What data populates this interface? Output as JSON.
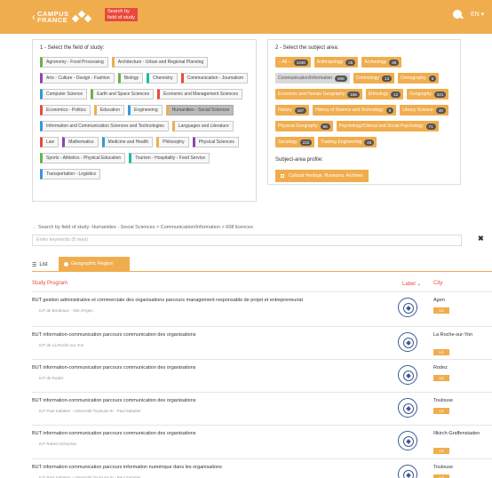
{
  "header": {
    "logo_line1": "CAMPUS",
    "logo_line2": "FRANCE",
    "search_line1": "Search by",
    "search_line2": "field of study",
    "lang": "EN"
  },
  "fields_panel": {
    "title": "1 - Select the field of study:",
    "items": [
      {
        "label": "Agronomy - Food Processing",
        "color": "c-green",
        "selected": false
      },
      {
        "label": "Architecture - Urban and Regional Planning",
        "color": "c-orange",
        "selected": false
      },
      {
        "label": "Arts - Culture - Design - Fashion",
        "color": "c-purple",
        "selected": false
      },
      {
        "label": "Biology",
        "color": "c-green",
        "selected": false
      },
      {
        "label": "Chemistry",
        "color": "c-teal",
        "selected": false
      },
      {
        "label": "Communication - Journalism",
        "color": "c-red",
        "selected": false
      },
      {
        "label": "Computer Science",
        "color": "c-blue",
        "selected": false
      },
      {
        "label": "Earth and Space Sciences",
        "color": "c-green",
        "selected": false
      },
      {
        "label": "Economic and Management Sciences",
        "color": "c-red",
        "selected": false
      },
      {
        "label": "Economics - Politics",
        "color": "c-red",
        "selected": false
      },
      {
        "label": "Education",
        "color": "c-orange",
        "selected": false
      },
      {
        "label": "Engineering",
        "color": "c-blue",
        "selected": false
      },
      {
        "label": "Humanities - Social Sciences",
        "color": "c-orange",
        "selected": true
      },
      {
        "label": "Information and Communication Sciences and Technologies",
        "color": "c-blue",
        "selected": false
      },
      {
        "label": "Languages and Literature",
        "color": "c-orange",
        "selected": false
      },
      {
        "label": "Law",
        "color": "c-red",
        "selected": false
      },
      {
        "label": "Mathematics",
        "color": "c-purple",
        "selected": false
      },
      {
        "label": "Medicine and Health",
        "color": "c-blue",
        "selected": false
      },
      {
        "label": "Philosophy",
        "color": "c-orange",
        "selected": false
      },
      {
        "label": "Physical Sciences",
        "color": "c-purple",
        "selected": false
      },
      {
        "label": "Sports - Athletics - Physical Education",
        "color": "c-green",
        "selected": false
      },
      {
        "label": "Tourism - Hospitality - Food Service",
        "color": "c-teal",
        "selected": false
      },
      {
        "label": "Transportation - Logistics",
        "color": "c-blue",
        "selected": false
      }
    ]
  },
  "subjects_panel": {
    "title": "2 - Select the subject area:",
    "items": [
      {
        "label": "-- All --",
        "count": "1436",
        "selected": false
      },
      {
        "label": "Anthropology",
        "count": "25",
        "selected": false
      },
      {
        "label": "Archeology",
        "count": "46",
        "selected": false
      },
      {
        "label": "Communication/Information",
        "count": "608",
        "selected": true
      },
      {
        "label": "Criminology",
        "count": "13",
        "selected": false
      },
      {
        "label": "Demography",
        "count": "5",
        "selected": false
      },
      {
        "label": "Economic and Human Geography",
        "count": "156",
        "selected": false
      },
      {
        "label": "Ethnology",
        "count": "12",
        "selected": false
      },
      {
        "label": "Geography",
        "count": "321",
        "selected": false
      },
      {
        "label": "History",
        "count": "187",
        "selected": false
      },
      {
        "label": "History of Science and Technology",
        "count": "9",
        "selected": false
      },
      {
        "label": "Library Science",
        "count": "49",
        "selected": false
      },
      {
        "label": "Physical Geography",
        "count": "66",
        "selected": false
      },
      {
        "label": "Psychology/Clinical and Social Psychology",
        "count": "71",
        "selected": false
      },
      {
        "label": "Sociology",
        "count": "222",
        "selected": false
      },
      {
        "label": "Training Engineering",
        "count": "46",
        "selected": false
      }
    ],
    "profile_label": "Subject-area profile:",
    "profile_button": "Cultural Heritage, Museums, Archives"
  },
  "breadcrumb": "Search by field of study: Humanities - Social Sciences > Communication/Information > 608 licences",
  "keywords_placeholder": "Enter keywords (5 max)",
  "tabs": {
    "list": "List",
    "geo": "Geographic Region"
  },
  "table": {
    "col_program": "Study Program",
    "col_label": "Label",
    "col_city": "City",
    "rows": [
      {
        "title": "BUT gestion administrative et commerciale des organisations parcours management responsable de projet et entrepreneuriat",
        "institution": "IUT de Bordeaux - Site d'Agen",
        "city": "Agen",
        "level": "L3"
      },
      {
        "title": "BUT information-communication parcours communication des organisations",
        "institution": "IUT de La Roche sur Yon",
        "city": "La Roche-sur-Yon",
        "level": "L3"
      },
      {
        "title": "BUT information-communication parcours communication des organisations",
        "institution": "IUT de Rodez",
        "city": "Rodez",
        "level": "L3"
      },
      {
        "title": "BUT information-communication parcours communication des organisations",
        "institution": "IUT Paul Sabatier - Université Toulouse III - Paul Sabatier",
        "city": "Toulouse",
        "level": "L3"
      },
      {
        "title": "BUT information-communication parcours communication des organisations",
        "institution": "IUT Robert Schuman",
        "city": "Illkirch-Graffenstaden",
        "level": "L3"
      },
      {
        "title": "BUT information-communication parcours information numérique dans les organisations",
        "institution": "IUT Paul Sabatier - Université Toulouse III - Paul Sabatier",
        "city": "Toulouse",
        "level": "L3"
      }
    ]
  }
}
